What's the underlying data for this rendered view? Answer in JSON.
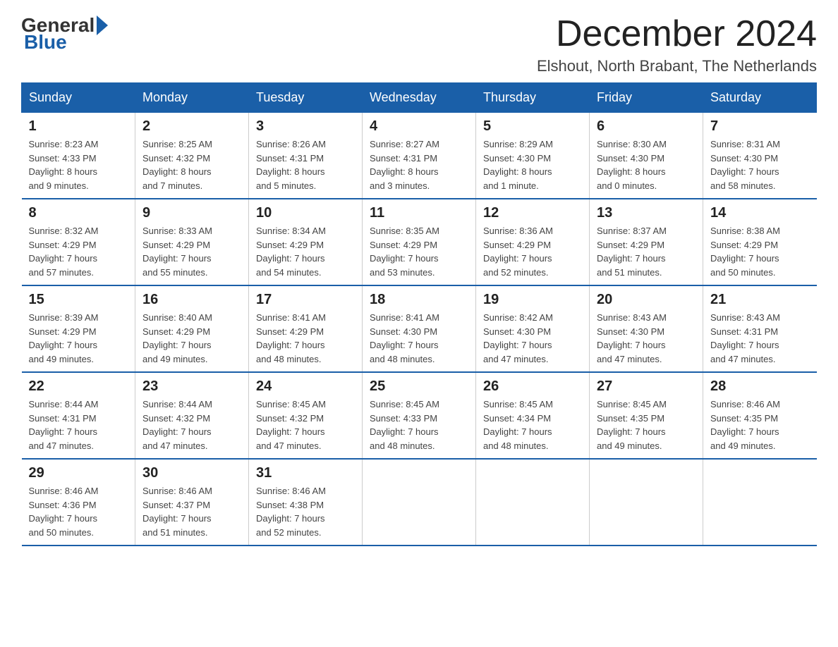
{
  "logo": {
    "general": "General",
    "blue": "Blue"
  },
  "title": "December 2024",
  "location": "Elshout, North Brabant, The Netherlands",
  "days_of_week": [
    "Sunday",
    "Monday",
    "Tuesday",
    "Wednesday",
    "Thursday",
    "Friday",
    "Saturday"
  ],
  "weeks": [
    [
      {
        "day": "1",
        "info": "Sunrise: 8:23 AM\nSunset: 4:33 PM\nDaylight: 8 hours\nand 9 minutes."
      },
      {
        "day": "2",
        "info": "Sunrise: 8:25 AM\nSunset: 4:32 PM\nDaylight: 8 hours\nand 7 minutes."
      },
      {
        "day": "3",
        "info": "Sunrise: 8:26 AM\nSunset: 4:31 PM\nDaylight: 8 hours\nand 5 minutes."
      },
      {
        "day": "4",
        "info": "Sunrise: 8:27 AM\nSunset: 4:31 PM\nDaylight: 8 hours\nand 3 minutes."
      },
      {
        "day": "5",
        "info": "Sunrise: 8:29 AM\nSunset: 4:30 PM\nDaylight: 8 hours\nand 1 minute."
      },
      {
        "day": "6",
        "info": "Sunrise: 8:30 AM\nSunset: 4:30 PM\nDaylight: 8 hours\nand 0 minutes."
      },
      {
        "day": "7",
        "info": "Sunrise: 8:31 AM\nSunset: 4:30 PM\nDaylight: 7 hours\nand 58 minutes."
      }
    ],
    [
      {
        "day": "8",
        "info": "Sunrise: 8:32 AM\nSunset: 4:29 PM\nDaylight: 7 hours\nand 57 minutes."
      },
      {
        "day": "9",
        "info": "Sunrise: 8:33 AM\nSunset: 4:29 PM\nDaylight: 7 hours\nand 55 minutes."
      },
      {
        "day": "10",
        "info": "Sunrise: 8:34 AM\nSunset: 4:29 PM\nDaylight: 7 hours\nand 54 minutes."
      },
      {
        "day": "11",
        "info": "Sunrise: 8:35 AM\nSunset: 4:29 PM\nDaylight: 7 hours\nand 53 minutes."
      },
      {
        "day": "12",
        "info": "Sunrise: 8:36 AM\nSunset: 4:29 PM\nDaylight: 7 hours\nand 52 minutes."
      },
      {
        "day": "13",
        "info": "Sunrise: 8:37 AM\nSunset: 4:29 PM\nDaylight: 7 hours\nand 51 minutes."
      },
      {
        "day": "14",
        "info": "Sunrise: 8:38 AM\nSunset: 4:29 PM\nDaylight: 7 hours\nand 50 minutes."
      }
    ],
    [
      {
        "day": "15",
        "info": "Sunrise: 8:39 AM\nSunset: 4:29 PM\nDaylight: 7 hours\nand 49 minutes."
      },
      {
        "day": "16",
        "info": "Sunrise: 8:40 AM\nSunset: 4:29 PM\nDaylight: 7 hours\nand 49 minutes."
      },
      {
        "day": "17",
        "info": "Sunrise: 8:41 AM\nSunset: 4:29 PM\nDaylight: 7 hours\nand 48 minutes."
      },
      {
        "day": "18",
        "info": "Sunrise: 8:41 AM\nSunset: 4:30 PM\nDaylight: 7 hours\nand 48 minutes."
      },
      {
        "day": "19",
        "info": "Sunrise: 8:42 AM\nSunset: 4:30 PM\nDaylight: 7 hours\nand 47 minutes."
      },
      {
        "day": "20",
        "info": "Sunrise: 8:43 AM\nSunset: 4:30 PM\nDaylight: 7 hours\nand 47 minutes."
      },
      {
        "day": "21",
        "info": "Sunrise: 8:43 AM\nSunset: 4:31 PM\nDaylight: 7 hours\nand 47 minutes."
      }
    ],
    [
      {
        "day": "22",
        "info": "Sunrise: 8:44 AM\nSunset: 4:31 PM\nDaylight: 7 hours\nand 47 minutes."
      },
      {
        "day": "23",
        "info": "Sunrise: 8:44 AM\nSunset: 4:32 PM\nDaylight: 7 hours\nand 47 minutes."
      },
      {
        "day": "24",
        "info": "Sunrise: 8:45 AM\nSunset: 4:32 PM\nDaylight: 7 hours\nand 47 minutes."
      },
      {
        "day": "25",
        "info": "Sunrise: 8:45 AM\nSunset: 4:33 PM\nDaylight: 7 hours\nand 48 minutes."
      },
      {
        "day": "26",
        "info": "Sunrise: 8:45 AM\nSunset: 4:34 PM\nDaylight: 7 hours\nand 48 minutes."
      },
      {
        "day": "27",
        "info": "Sunrise: 8:45 AM\nSunset: 4:35 PM\nDaylight: 7 hours\nand 49 minutes."
      },
      {
        "day": "28",
        "info": "Sunrise: 8:46 AM\nSunset: 4:35 PM\nDaylight: 7 hours\nand 49 minutes."
      }
    ],
    [
      {
        "day": "29",
        "info": "Sunrise: 8:46 AM\nSunset: 4:36 PM\nDaylight: 7 hours\nand 50 minutes."
      },
      {
        "day": "30",
        "info": "Sunrise: 8:46 AM\nSunset: 4:37 PM\nDaylight: 7 hours\nand 51 minutes."
      },
      {
        "day": "31",
        "info": "Sunrise: 8:46 AM\nSunset: 4:38 PM\nDaylight: 7 hours\nand 52 minutes."
      },
      {
        "day": "",
        "info": ""
      },
      {
        "day": "",
        "info": ""
      },
      {
        "day": "",
        "info": ""
      },
      {
        "day": "",
        "info": ""
      }
    ]
  ]
}
